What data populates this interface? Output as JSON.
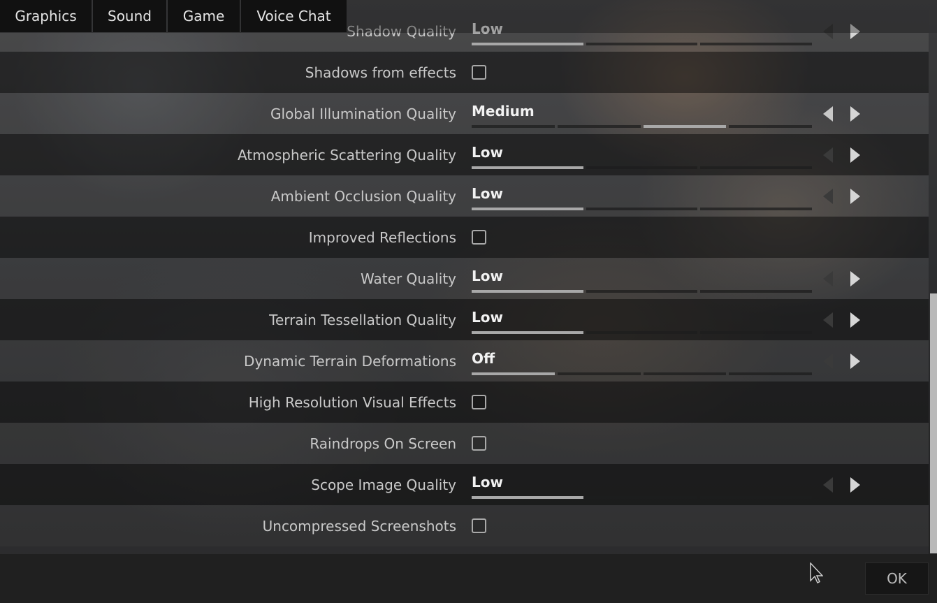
{
  "tabs": [
    {
      "label": "Graphics",
      "active": true
    },
    {
      "label": "Sound",
      "active": false
    },
    {
      "label": "Game",
      "active": false
    },
    {
      "label": "Voice Chat",
      "active": false
    }
  ],
  "settings": [
    {
      "label": "Shadow Quality",
      "type": "selector",
      "value": "Low",
      "level_index": 0,
      "levels": 3
    },
    {
      "label": "Shadows from effects",
      "type": "checkbox",
      "checked": false
    },
    {
      "label": "Global Illumination Quality",
      "type": "selector",
      "value": "Medium",
      "level_index": 2,
      "levels": 4
    },
    {
      "label": "Atmospheric Scattering Quality",
      "type": "selector",
      "value": "Low",
      "level_index": 0,
      "levels": 3
    },
    {
      "label": "Ambient Occlusion Quality",
      "type": "selector",
      "value": "Low",
      "level_index": 0,
      "levels": 3
    },
    {
      "label": "Improved Reflections",
      "type": "checkbox",
      "checked": false
    },
    {
      "label": "Water Quality",
      "type": "selector",
      "value": "Low",
      "level_index": 0,
      "levels": 3
    },
    {
      "label": "Terrain Tessellation Quality",
      "type": "selector",
      "value": "Low",
      "level_index": 0,
      "levels": 3
    },
    {
      "label": "Dynamic Terrain Deformations",
      "type": "selector",
      "value": "Off",
      "level_index": 0,
      "levels": 4
    },
    {
      "label": "High Resolution Visual Effects",
      "type": "checkbox",
      "checked": false
    },
    {
      "label": "Raindrops On Screen",
      "type": "checkbox",
      "checked": false
    },
    {
      "label": "Scope Image Quality",
      "type": "selector",
      "value": "Low",
      "level_index": 0,
      "levels": 3
    },
    {
      "label": "Uncompressed Screenshots",
      "type": "checkbox",
      "checked": false
    }
  ],
  "footer": {
    "ok_label": "OK"
  },
  "icons": {
    "left": "chevron-left-icon",
    "right": "chevron-right-icon",
    "cursor": "mouse-cursor-icon"
  },
  "colors": {
    "active_tab": "#c8c8c8",
    "segment_on": "#a8a8a8",
    "panel": "#111111"
  }
}
